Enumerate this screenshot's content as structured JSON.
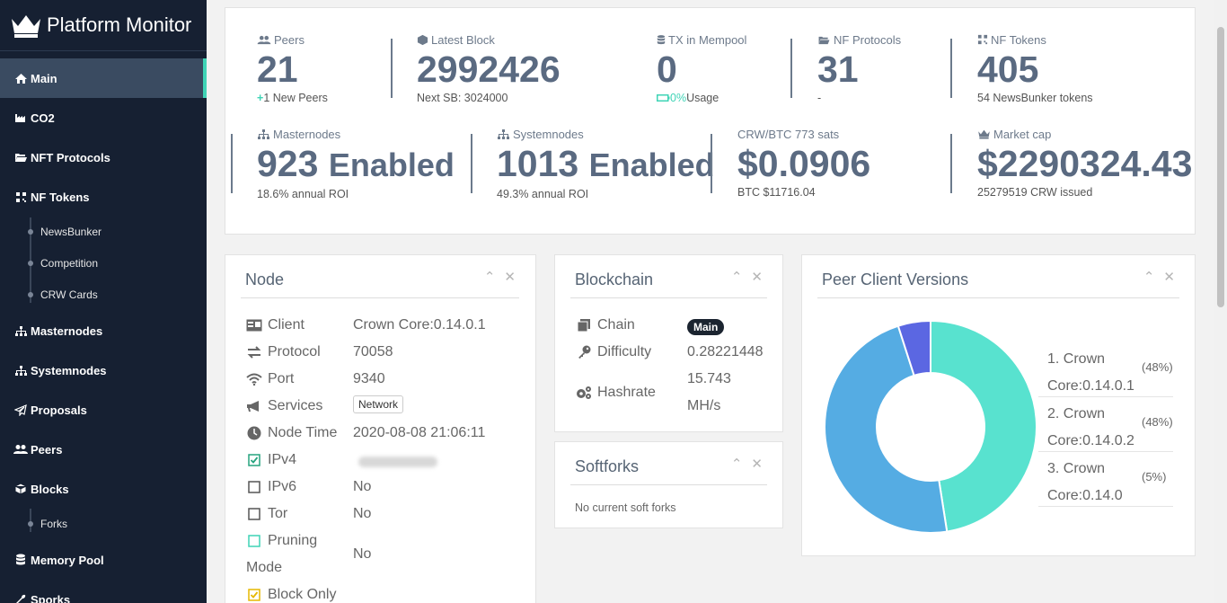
{
  "brand": {
    "title": "Platform Monitor"
  },
  "sidebar": {
    "items": [
      {
        "label": "Main",
        "icon": "home-icon"
      },
      {
        "label": "CO2",
        "icon": "industry-icon"
      },
      {
        "label": "NFT Protocols",
        "icon": "folder-open-icon"
      },
      {
        "label": "NF Tokens",
        "icon": "qrcode-icon"
      },
      {
        "label": "Masternodes",
        "icon": "sitemap-icon"
      },
      {
        "label": "Systemnodes",
        "icon": "sitemap-icon"
      },
      {
        "label": "Proposals",
        "icon": "paper-plane-icon"
      },
      {
        "label": "Peers",
        "icon": "users-icon"
      },
      {
        "label": "Blocks",
        "icon": "cube-icon"
      },
      {
        "label": "Memory Pool",
        "icon": "database-icon"
      },
      {
        "label": "Sporks",
        "icon": "wrench-icon"
      }
    ],
    "subitems": {
      "nf_tokens": [
        "NewsBunker",
        "Competition",
        "CRW Cards"
      ],
      "blocks": [
        "Forks"
      ]
    }
  },
  "stats": {
    "peers": {
      "label": "Peers",
      "value": "21",
      "sub_prefix": "+",
      "sub": "1 New Peers"
    },
    "latest_block": {
      "label": "Latest Block",
      "value": "2992426",
      "sub": "Next SB: 3024000"
    },
    "mempool": {
      "label": "TX in Mempool",
      "value": "0",
      "sub_pct": "0%",
      "sub": " Usage"
    },
    "nf_protocols": {
      "label": "NF Protocols",
      "value": "31",
      "sub": "-"
    },
    "nf_tokens": {
      "label": "NF Tokens",
      "value": "405",
      "sub": "54 NewsBunker tokens"
    },
    "masternodes": {
      "label": "Masternodes",
      "value": "923",
      "value_suffix": "Enabled",
      "sub": "18.6% annual ROI"
    },
    "systemnodes": {
      "label": "Systemnodes",
      "value": "1013",
      "value_suffix": "Enabled",
      "sub": "49.3% annual ROI"
    },
    "price": {
      "label": "CRW/BTC 773 sats",
      "value": "$0.0906",
      "sub": "BTC $11716.04"
    },
    "market_cap": {
      "label": "Market cap",
      "value": "$2290324.43",
      "sub": "25279519 CRW issued"
    }
  },
  "node": {
    "title": "Node",
    "rows": [
      {
        "key": "Client",
        "value": "Crown Core:0.14.0.1"
      },
      {
        "key": "Protocol",
        "value": "70058"
      },
      {
        "key": "Port",
        "value": "9340"
      },
      {
        "key": "Services",
        "value": "Network"
      },
      {
        "key": "Node Time",
        "value": "2020-08-08 21:06:11"
      },
      {
        "key": "IPv4",
        "value": ""
      },
      {
        "key": "IPv6",
        "value": "No"
      },
      {
        "key": "Tor",
        "value": "No"
      },
      {
        "key": "Pruning",
        "key2": "Mode",
        "value": "No"
      },
      {
        "key": "Block Only",
        "value": ""
      }
    ]
  },
  "blockchain": {
    "title": "Blockchain",
    "rows": [
      {
        "key": "Chain",
        "value": "Main"
      },
      {
        "key": "Difficulty",
        "value": "0.28221448"
      },
      {
        "key": "Hashrate",
        "value": "15.743",
        "value2": "MH/s"
      }
    ]
  },
  "softforks": {
    "title": "Softforks",
    "empty_text": "No current soft forks"
  },
  "peer_versions": {
    "title": "Peer Client Versions",
    "legend": [
      {
        "line1": "1. Crown",
        "line2": "Core:0.14.0.1",
        "pct": "(48%)"
      },
      {
        "line1": "2. Crown",
        "line2": "Core:0.14.0.2",
        "pct": "(48%)"
      },
      {
        "line1": "3. Crown",
        "line2": "Core:0.14.0",
        "pct": "(5%)"
      }
    ]
  },
  "chart_data": {
    "type": "pie",
    "title": "Peer Client Versions",
    "categories": [
      "Crown Core:0.14.0.1",
      "Crown Core:0.14.0.2",
      "Crown Core:0.14.0"
    ],
    "values": [
      48,
      48,
      5
    ],
    "colors": [
      "#58e2cf",
      "#55ace3",
      "#5b67e2"
    ],
    "donut": true
  },
  "colors": {
    "accent": "#3fd4b6",
    "sidebar_bg": "#162032",
    "stat_value": "#5a6a81"
  }
}
